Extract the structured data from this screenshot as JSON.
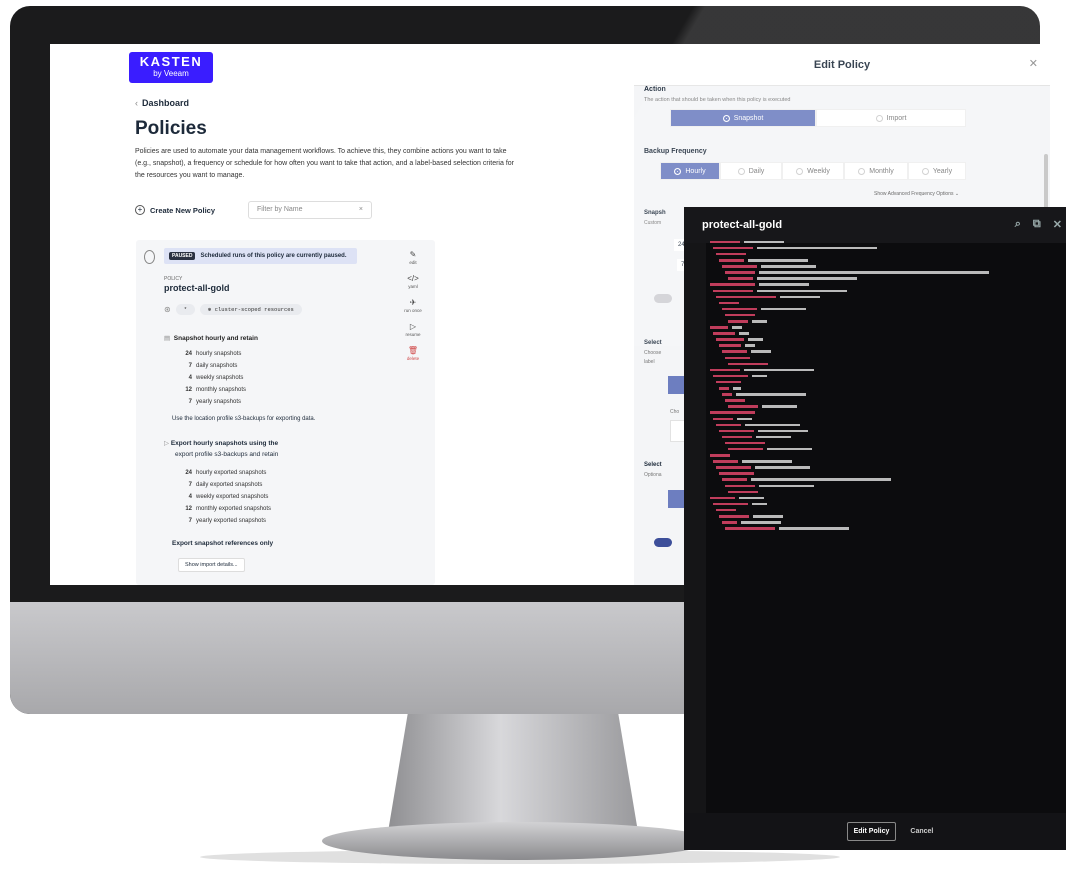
{
  "logo": {
    "line1": "KASTEN",
    "line2": "by Veeam"
  },
  "breadcrumb": "Dashboard",
  "page_title": "Policies",
  "page_description": "Policies are used to automate your data management workflows. To achieve this, they combine actions you want to take (e.g., snapshot), a frequency or schedule for how often you want to take that action, and a label-based selection criteria for the resources you want to manage.",
  "create_button": "Create New Policy",
  "filter_placeholder": "Filter by Name",
  "policy_card": {
    "badge": "PAUSED",
    "paused_text": "Scheduled runs of this policy are currently paused.",
    "policy_label": "POLICY",
    "policy_name": "protect-all-gold",
    "chip_star": "*",
    "chip_resources": "cluster-scoped resources",
    "snapshot_header": "Snapshot hourly and retain",
    "snapshots": [
      {
        "count": "24",
        "label": "hourly snapshots"
      },
      {
        "count": "7",
        "label": "daily snapshots"
      },
      {
        "count": "4",
        "label": "weekly snapshots"
      },
      {
        "count": "12",
        "label": "monthly snapshots"
      },
      {
        "count": "7",
        "label": "yearly snapshots"
      }
    ],
    "location_text": "Use the location profile s3-backups for exporting data.",
    "export_header_1": "Export hourly snapshots using the",
    "export_header_2": "export profile s3-backups and retain",
    "exported": [
      {
        "count": "24",
        "label": "hourly exported snapshots"
      },
      {
        "count": "7",
        "label": "daily exported snapshots"
      },
      {
        "count": "4",
        "label": "weekly exported snapshots"
      },
      {
        "count": "12",
        "label": "monthly exported snapshots"
      },
      {
        "count": "7",
        "label": "yearly exported snapshots"
      }
    ],
    "export_refs": "Export snapshot references only",
    "show_import": "Show import details...",
    "actions": [
      {
        "icon": "edit-icon",
        "glyph": "✎",
        "label": "edit"
      },
      {
        "icon": "yaml-icon",
        "glyph": "</>",
        "label": "yaml"
      },
      {
        "icon": "run-icon",
        "glyph": "✈",
        "label": "run once"
      },
      {
        "icon": "resume-icon",
        "glyph": "▷",
        "label": "resume"
      },
      {
        "icon": "delete-icon",
        "glyph": "🗑",
        "label": "delete"
      }
    ]
  },
  "edit_policy": {
    "title": "Edit Policy",
    "action_title": "Action",
    "action_desc": "The action that should be taken when this policy is executed",
    "action_options": [
      "Snapshot",
      "Import"
    ],
    "frequency_title": "Backup Frequency",
    "frequency_options": [
      "Hourly",
      "Daily",
      "Weekly",
      "Monthly",
      "Yearly"
    ],
    "advanced_link": "Show Advanced Frequency Options ⌄",
    "snapshot_partial": "Snapsh",
    "snapshot_partial_desc": "Custom",
    "row_24": "24",
    "row_7": "7",
    "select_partial": "Select",
    "select_partial_desc": "Choose",
    "label_partial": "label",
    "choose_partial": "Cho",
    "select_partial_2": "Select",
    "optional_partial": "Optiona"
  },
  "yaml_editor": {
    "title": "protect-all-gold",
    "edit_button": "Edit Policy",
    "cancel_button": "Cancel"
  },
  "colors": {
    "brand": "#3a1dff",
    "accent": "#6d7ec0",
    "yaml_key": "#e0466a",
    "yaml_string": "#d8d26a"
  }
}
